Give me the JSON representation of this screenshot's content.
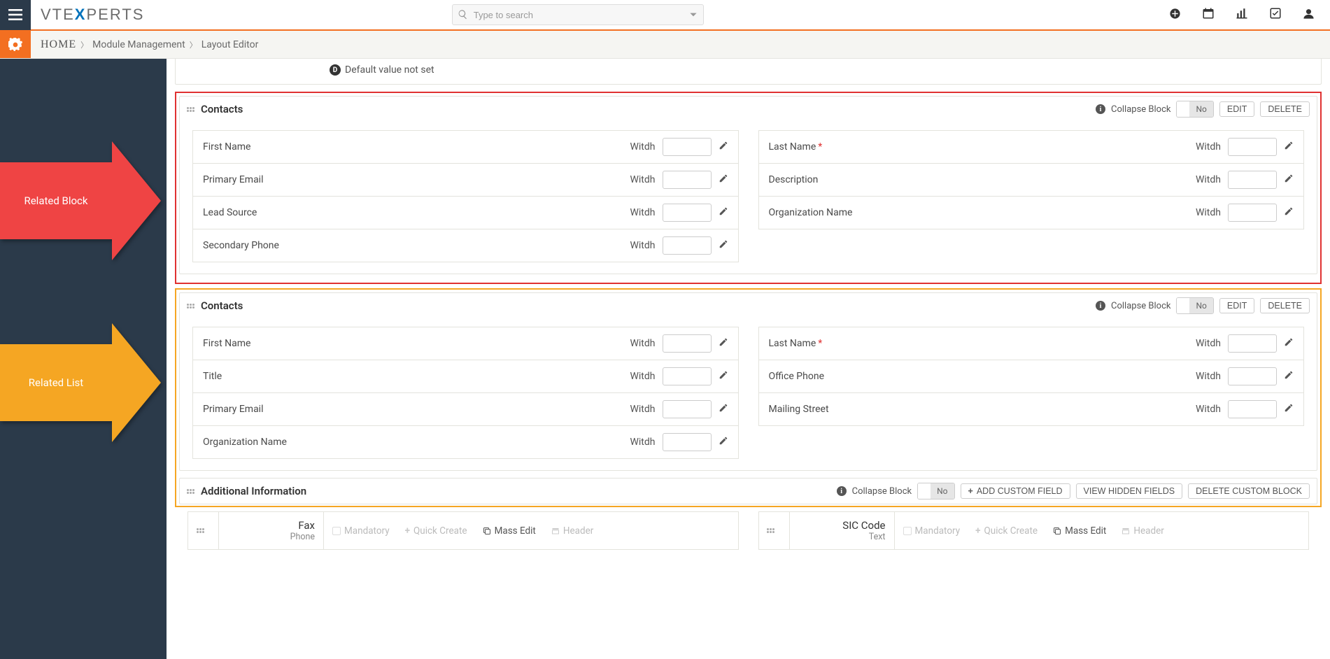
{
  "search": {
    "placeholder": "Type to search"
  },
  "breadcrumb": {
    "home": "HOME",
    "a": "Module Management",
    "b": "Layout Editor"
  },
  "arrows": {
    "block": "Related Block",
    "list": "Related List"
  },
  "defaultnote": "Default value not set",
  "collapse_label": "Collapse Block",
  "toggle_no": "No",
  "btn": {
    "edit": "EDIT",
    "delete": "DELETE",
    "addfield": "ADD CUSTOM FIELD",
    "viewhidden": "VIEW HIDDEN FIELDS",
    "deleteblock": "DELETE CUSTOM BLOCK"
  },
  "width_label": "Witdh",
  "blocks": {
    "b1": {
      "title": "Contacts",
      "left": [
        "First Name",
        "Primary Email",
        "Lead Source",
        "Secondary Phone"
      ],
      "right": [
        "Last Name",
        "Description",
        "Organization Name"
      ],
      "required_right_0": true
    },
    "b2": {
      "title": "Contacts",
      "left": [
        "First Name",
        "Title",
        "Primary Email",
        "Organization Name"
      ],
      "right": [
        "Last Name",
        "Office Phone",
        "Mailing Street"
      ],
      "required_right_0": true
    },
    "b3": {
      "title": "Additional Information"
    }
  },
  "cards": {
    "left": {
      "name": "Fax",
      "type": "Phone"
    },
    "right": {
      "name": "SIC Code",
      "type": "Text"
    }
  },
  "opt": {
    "mandatory": "Mandatory",
    "quick": "Quick Create",
    "mass": "Mass Edit",
    "header": "Header"
  }
}
